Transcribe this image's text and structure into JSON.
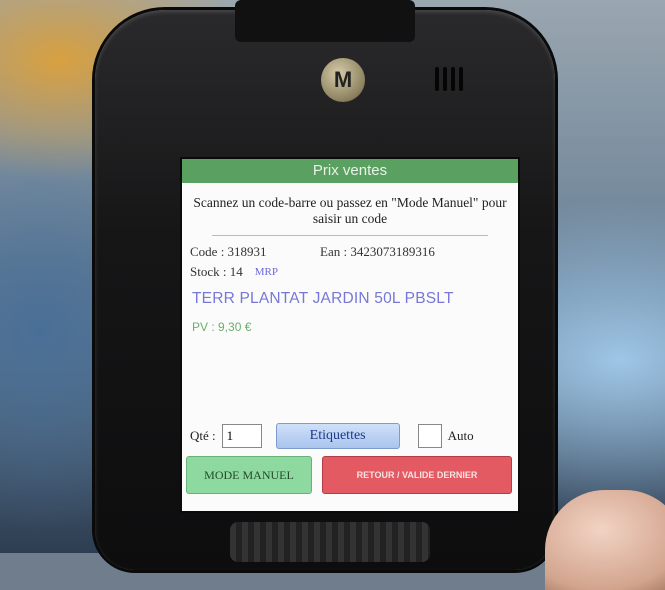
{
  "device": {
    "brand_logo": "M"
  },
  "app": {
    "title": "Prix ventes",
    "instruction": "Scannez un code-barre ou passez en \"Mode Manuel\" pour saisir un code"
  },
  "product": {
    "code_text": "Code : 318931",
    "ean_text": "Ean : 3423073189316",
    "stock_text": "Stock : 14",
    "mrp_label": "MRP",
    "name": "TERR PLANTAT JARDIN 50L PBSLT",
    "pv_text": "PV : 9,30 €"
  },
  "controls": {
    "qte_label": "Qté :",
    "qte_value": "1",
    "etiquettes_label": "Etiquettes",
    "auto_label": "Auto",
    "mode_manuel_label": "MODE MANUEL",
    "retour_label": "RETOUR / VALIDE DERNIER"
  },
  "colors": {
    "titlebar": "#5aa060",
    "product_name": "#7777d8",
    "mode_manuel_button": "#8ed9a0",
    "retour_button": "#e45a62"
  }
}
